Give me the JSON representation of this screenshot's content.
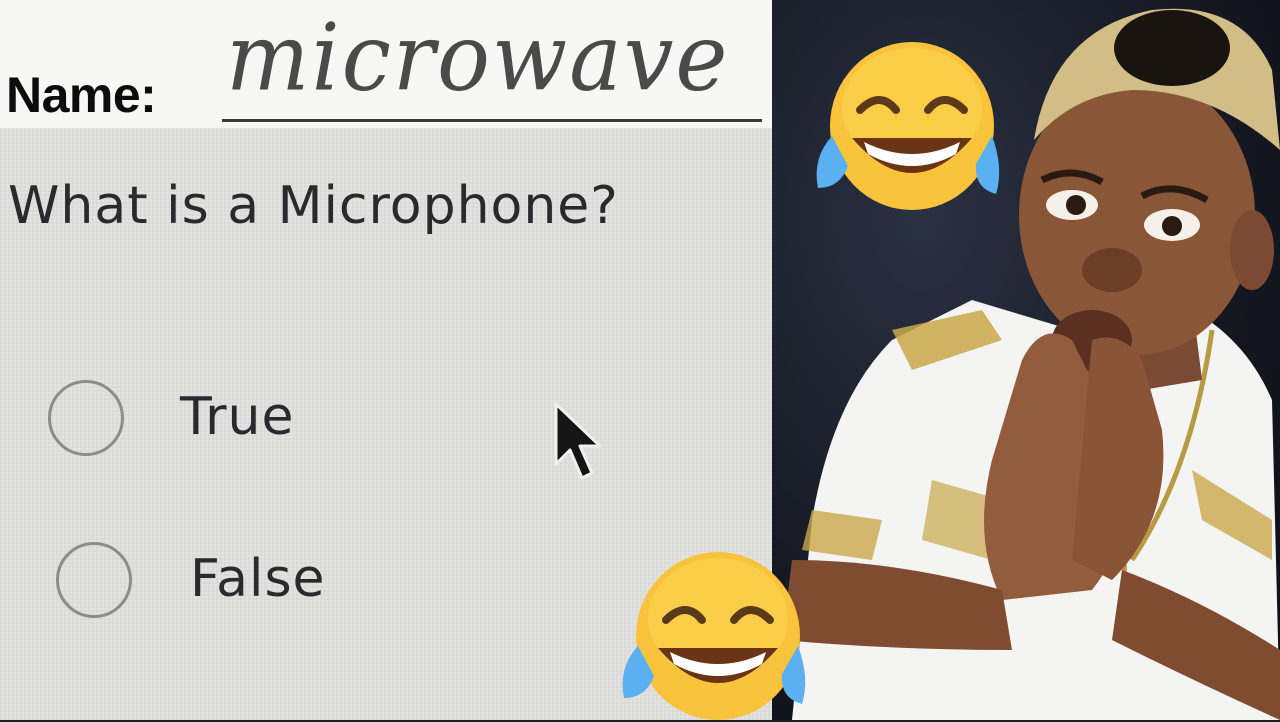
{
  "quiz": {
    "name_label": "Name:",
    "name_value": "microwave",
    "question": "What is a Microphone?",
    "options": [
      {
        "label": "True",
        "selected": false
      },
      {
        "label": "False",
        "selected": false
      }
    ]
  },
  "icons": {
    "cursor": "arrow-cursor-icon",
    "emoji": "face-with-tears-of-joy-icon"
  },
  "colors": {
    "paper": "#f7f7f5",
    "screen": "#e3e3e1",
    "text": "#2a2a2e",
    "shirt": "#f4f4f2",
    "gold": "#c9a74a"
  }
}
